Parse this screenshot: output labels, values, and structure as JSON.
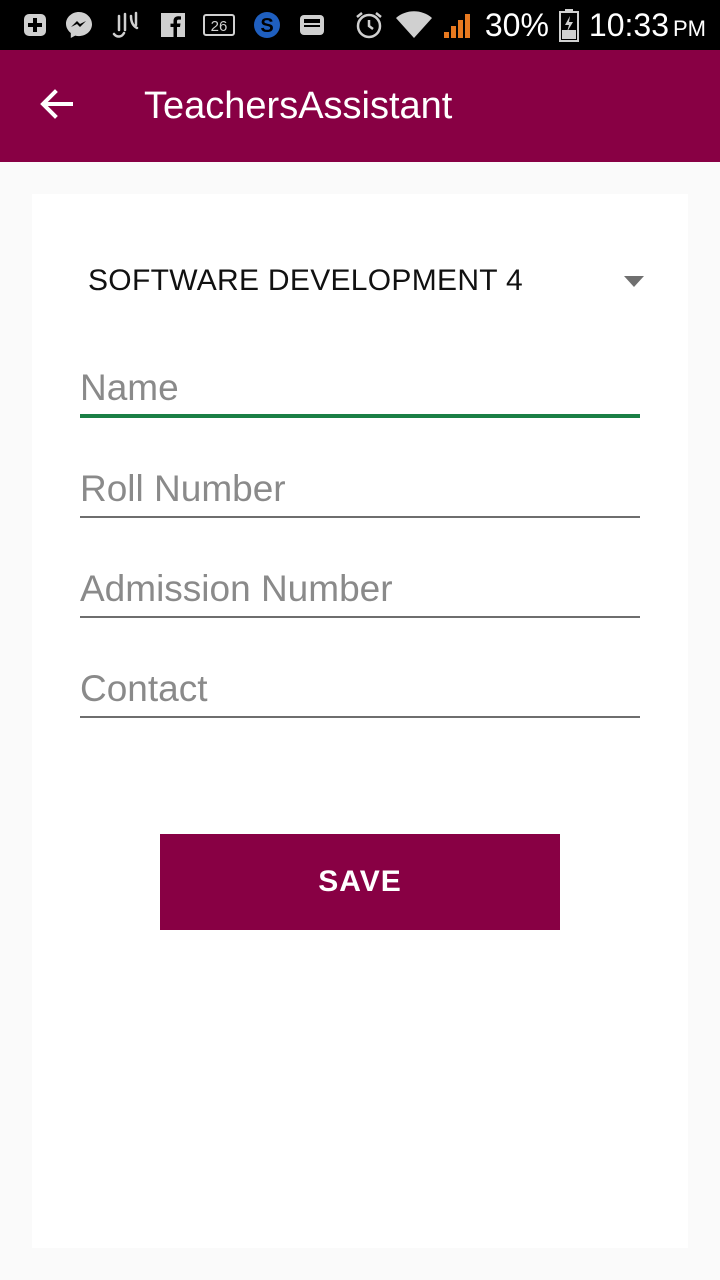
{
  "status_bar": {
    "icons": [
      "plus-notification-icon",
      "messenger-icon",
      "arabic-app-icon",
      "facebook-icon",
      "calendar-icon",
      "s-app-icon",
      "inbox-icon",
      "alarm-icon",
      "wifi-icon",
      "signal-icon",
      "battery-icon"
    ],
    "calendar_day": "26",
    "battery": "30%",
    "time": "10:33",
    "ampm": "PM"
  },
  "app_bar": {
    "title": "TeachersAssistant",
    "back_icon": "arrow-back-icon",
    "color": "#880044"
  },
  "form": {
    "course_spinner": {
      "selected": "SOFTWARE DEVELOPMENT 4"
    },
    "fields": {
      "name": {
        "placeholder": "Name",
        "value": ""
      },
      "roll_number": {
        "placeholder": "Roll Number",
        "value": ""
      },
      "admission_number": {
        "placeholder": "Admission Number",
        "value": ""
      },
      "contact": {
        "placeholder": "Contact",
        "value": ""
      }
    },
    "save_label": "SAVE"
  },
  "colors": {
    "accent": "#880044",
    "focus_underline": "#1a7f45"
  }
}
